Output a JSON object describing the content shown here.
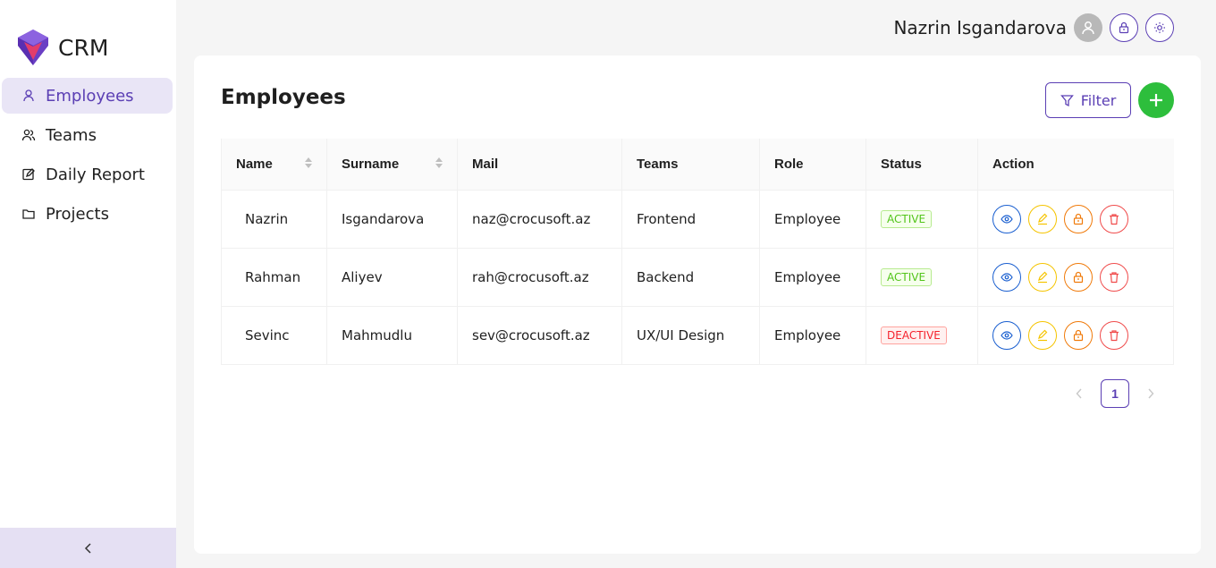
{
  "brand": {
    "name": "CRM"
  },
  "sidebar": {
    "items": [
      {
        "label": "Employees",
        "icon": "user-icon",
        "active": true
      },
      {
        "label": "Teams",
        "icon": "users-icon",
        "active": false
      },
      {
        "label": "Daily Report",
        "icon": "edit-report-icon",
        "active": false
      },
      {
        "label": "Projects",
        "icon": "folder-icon",
        "active": false
      }
    ],
    "collapse_icon": "chevron-left-icon"
  },
  "header": {
    "user_name": "Nazrin Isgandarova",
    "buttons": [
      "lock-icon",
      "sun-icon"
    ]
  },
  "main": {
    "title": "Employees",
    "filter_label": "Filter",
    "table": {
      "columns": [
        "Name",
        "Surname",
        "Mail",
        "Teams",
        "Role",
        "Status",
        "Action"
      ],
      "rows": [
        {
          "name": "Nazrin",
          "surname": "Isgandarova",
          "mail": "naz@crocusoft.az",
          "team": "Frontend",
          "role": "Employee",
          "status": "ACTIVE"
        },
        {
          "name": "Rahman",
          "surname": "Aliyev",
          "mail": "rah@crocusoft.az",
          "team": "Backend",
          "role": "Employee",
          "status": "ACTIVE"
        },
        {
          "name": "Sevinc",
          "surname": "Mahmudlu",
          "mail": "sev@crocusoft.az",
          "team": "UX/UI Design",
          "role": "Employee",
          "status": "DEACTIVE"
        }
      ]
    },
    "pagination": {
      "current_page": "1"
    }
  },
  "colors": {
    "accent": "#5b3fb4",
    "add": "#2dbe3c",
    "active": "#52c41a",
    "deactive": "#f5222d"
  }
}
